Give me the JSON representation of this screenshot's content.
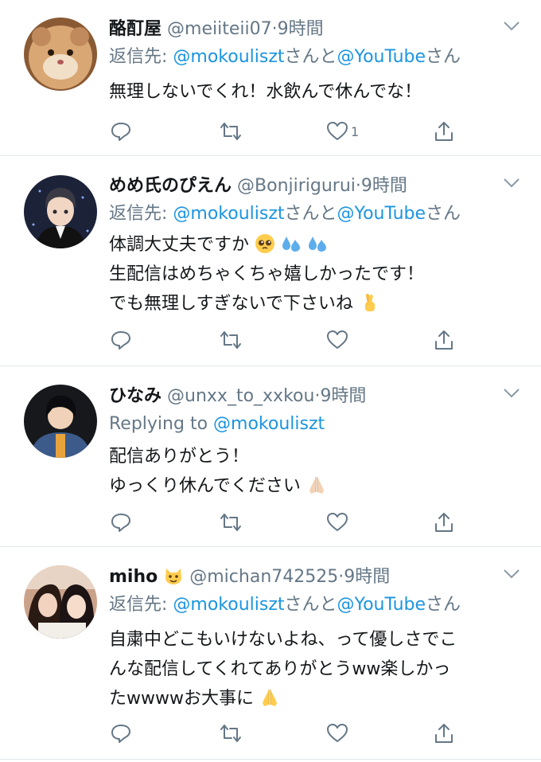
{
  "colors": {
    "link": "#1b95e0",
    "secondary": "#657786",
    "text": "#14171a",
    "divider": "#e1e8ed"
  },
  "tweets": [
    {
      "name": "酪酊屋",
      "handle": "@meiiteii07",
      "sep": "·",
      "time": "9時間",
      "reply_prefix": "返信先: ",
      "reply_mention1": "@mokouliszt",
      "reply_mid": "さんと",
      "reply_mention2": "@YouTube",
      "reply_suffix": "さん",
      "lines": [
        "無理しないでくれ！水飲んで休んでな！"
      ],
      "like_count": "1",
      "avatar": "hamster-avatar"
    },
    {
      "name": "めめ氏のぴえん",
      "handle": "@Bonjirigurui",
      "sep": "·",
      "time": "9時間",
      "reply_prefix": "返信先: ",
      "reply_mention1": "@mokouliszt",
      "reply_mid": "さんと",
      "reply_mention2": "@YouTube",
      "reply_suffix": "さん",
      "lines": [
        "体調大丈夫ですか",
        "生配信はめちゃくちゃ嬉しかったです！",
        "でも無理しすぎないで下さいね"
      ],
      "like_count": "",
      "avatar": "anime-boy-avatar"
    },
    {
      "name": "ひなみ",
      "handle": "@unxx_to_xxkou",
      "sep": "·",
      "time": "9時間",
      "reply_prefix": "Replying to ",
      "reply_mention1": "@mokouliszt",
      "reply_mid": "",
      "reply_mention2": "",
      "reply_suffix": "",
      "lines": [
        "配信ありがとう！",
        "ゆっくり休んでください"
      ],
      "like_count": "",
      "avatar": "illustration-avatar"
    },
    {
      "name": "miho",
      "handle": "@michan742525",
      "sep": "·",
      "time": "9時間",
      "reply_prefix": "返信先: ",
      "reply_mention1": "@mokouliszt",
      "reply_mid": "さんと",
      "reply_mention2": "@YouTube",
      "reply_suffix": "さん",
      "lines": [
        "自粛中どこもいけないよね、って優しさでこ",
        "んな配信してくれてありがとうww楽しかっ",
        "たwwwwお大事に"
      ],
      "like_count": "",
      "avatar": "photo-avatar"
    }
  ]
}
